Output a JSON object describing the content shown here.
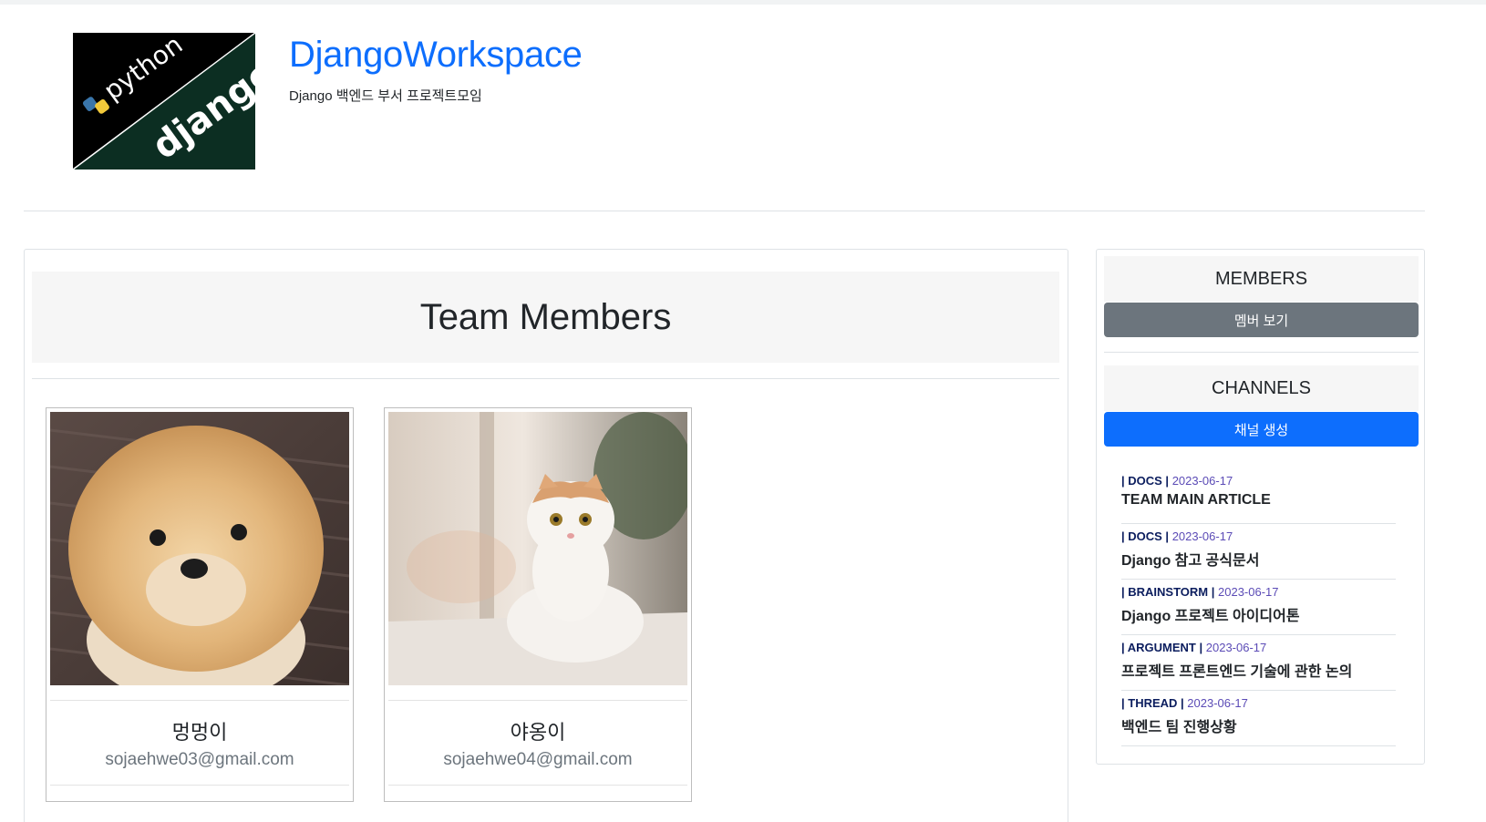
{
  "header": {
    "logo_text_top": "python",
    "logo_text_bottom": "django",
    "title": "DjangoWorkspace",
    "subtitle": "Django 백엔드 부서 프로젝트모임"
  },
  "main": {
    "heading": "Team Members",
    "members": [
      {
        "name": "멍멍이",
        "email": "sojaehwe03@gmail.com"
      },
      {
        "name": "야옹이",
        "email": "sojaehwe04@gmail.com"
      }
    ]
  },
  "sidebar": {
    "members_heading": "MEMBERS",
    "members_button": "멤버 보기",
    "channels_heading": "CHANNELS",
    "channels_button": "채널 생성",
    "channels": [
      {
        "meta_type": "| DOCS |",
        "date": "2023-06-17",
        "title": "TEAM MAIN ARTICLE"
      },
      {
        "meta_type": "| DOCS |",
        "date": "2023-06-17",
        "title": "Django 참고 공식문서"
      },
      {
        "meta_type": "| BRAINSTORM |",
        "date": "2023-06-17",
        "title": "Django 프로젝트 아이디어톤"
      },
      {
        "meta_type": "| ARGUMENT |",
        "date": "2023-06-17",
        "title": "프로젝트 프론트엔드 기술에 관한 논의"
      },
      {
        "meta_type": "| THREAD |",
        "date": "2023-06-17",
        "title": "백엔드 팀 진행상황"
      }
    ]
  },
  "colors": {
    "brand": "#0d6efd",
    "secondary_button": "#6c757d",
    "logo_background": "#0c2e22",
    "channel_type": "#0b1d5e",
    "channel_date": "#5b4bb6"
  }
}
